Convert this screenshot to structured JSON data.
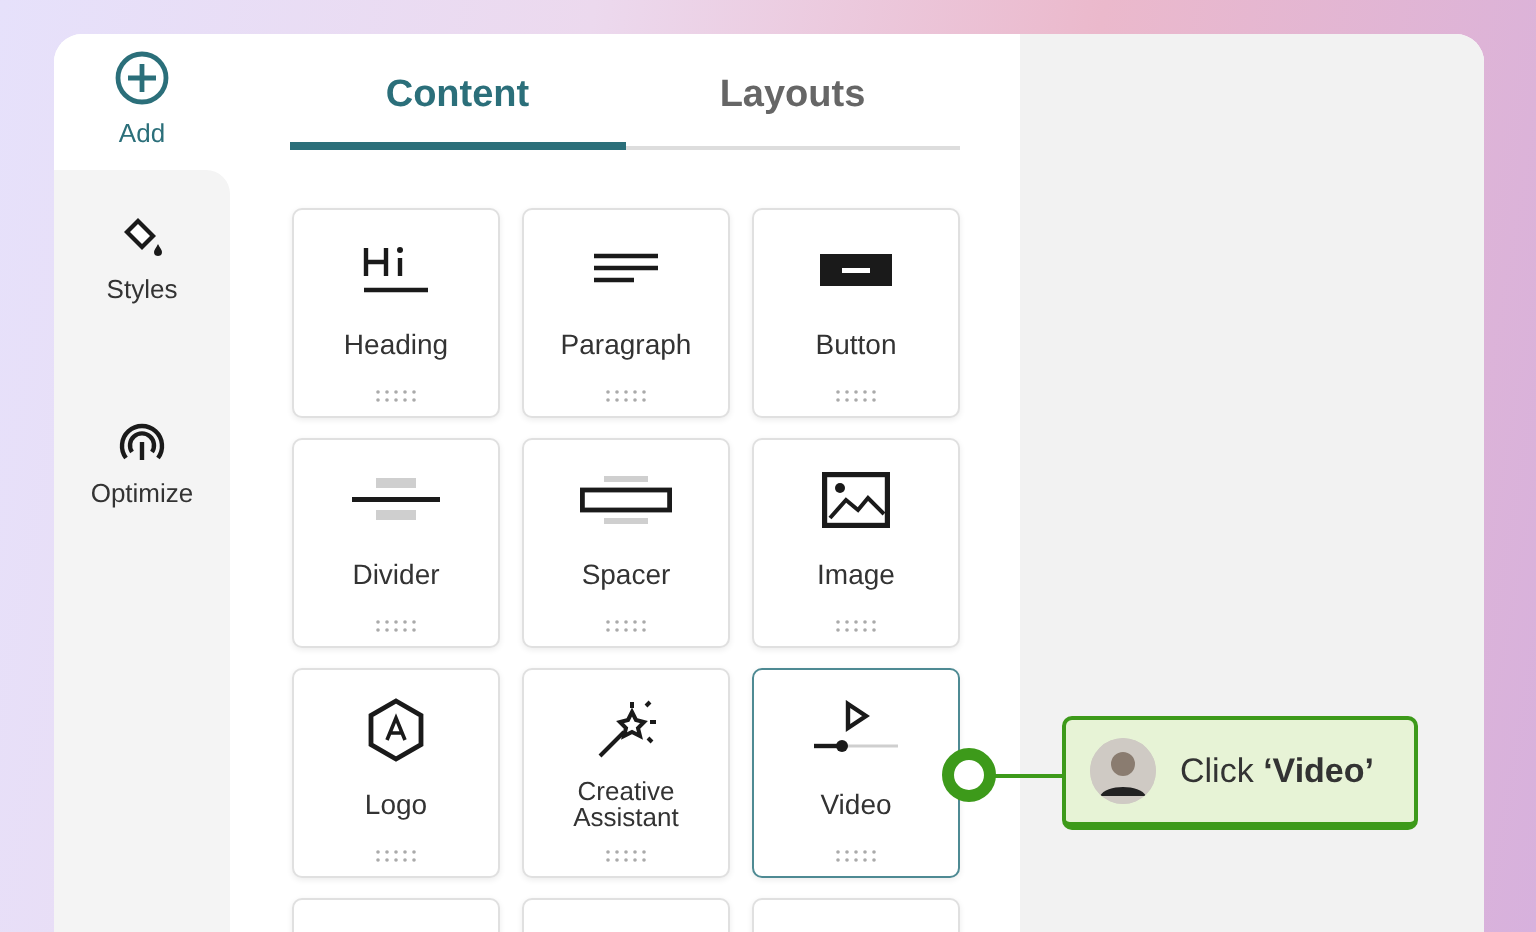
{
  "sidebar": {
    "items": [
      {
        "label": "Add",
        "selected": true
      },
      {
        "label": "Styles",
        "selected": false
      },
      {
        "label": "Optimize",
        "selected": false
      }
    ]
  },
  "tabs": [
    {
      "label": "Content",
      "selected": true
    },
    {
      "label": "Layouts",
      "selected": false
    }
  ],
  "tiles": [
    {
      "kind": "tile",
      "label": "Heading",
      "selected": false
    },
    {
      "kind": "tile",
      "label": "Paragraph",
      "selected": false
    },
    {
      "kind": "tile",
      "label": "Button",
      "selected": false
    },
    {
      "kind": "tile",
      "label": "Divider",
      "selected": false
    },
    {
      "kind": "tile",
      "label": "Spacer",
      "selected": false
    },
    {
      "kind": "tile",
      "label": "Image",
      "selected": false
    },
    {
      "kind": "tile",
      "label": "Logo",
      "selected": false
    },
    {
      "kind": "tile",
      "label": "Creative Assistant",
      "selected": false
    },
    {
      "kind": "tile",
      "label": "Video",
      "selected": true
    },
    {
      "kind": "cut"
    },
    {
      "kind": "cut"
    },
    {
      "kind": "cut"
    }
  ],
  "callout": {
    "text": "Click **‘Video’**"
  }
}
